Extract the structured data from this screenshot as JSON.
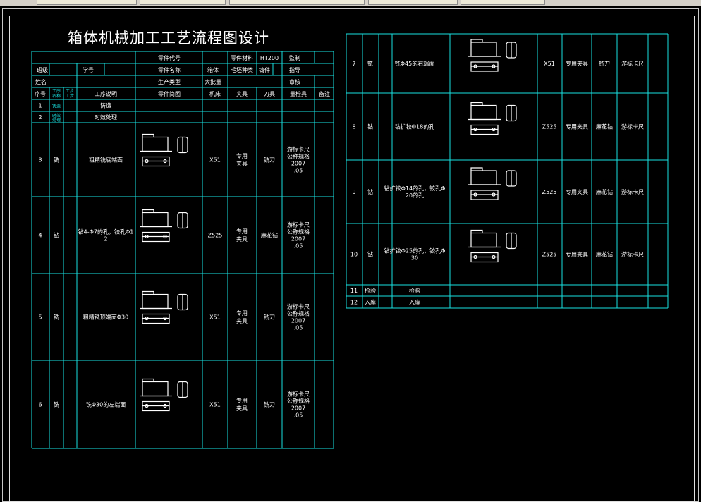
{
  "title": "箱体机械加工工艺流程图设计",
  "header": {
    "part_code_label": "零件代号",
    "part_name_label": "零件名称",
    "batch_label": "生产类型",
    "material_label": "零件材料",
    "material_value": "HT200",
    "blank_type_label": "毛坯种类",
    "blank_type_value": "铸件",
    "part_name_value": "箱体",
    "batch_value": "大批量",
    "made_label": "監制",
    "guide_label": "指导",
    "review_label": "审核",
    "class_label": "班级",
    "student_id_label": "学号",
    "name_label": "姓名"
  },
  "columns": {
    "seq": "序号",
    "proc_name": "工序名称",
    "step_name": "工步工步",
    "desc": "工序说明",
    "sketch": "零件简图",
    "machine": "机床",
    "fixture": "夹具",
    "tool": "刀具",
    "gauge": "量检具",
    "remark": "备注"
  },
  "left_rows": [
    {
      "seq": "1",
      "proc": "铸造",
      "desc": "铸造",
      "machine": "",
      "fixture": "",
      "tool": "",
      "gauge": ""
    },
    {
      "seq": "2",
      "proc": "时效处理",
      "desc": "时效处理",
      "machine": "",
      "fixture": "",
      "tool": "",
      "gauge": ""
    },
    {
      "seq": "3",
      "proc": "铣",
      "desc": "粗精铣底端面",
      "machine": "X51",
      "fixture": "专用夹具",
      "tool": "铣刀",
      "gauge": "游标卡尺公称规格2007.05"
    },
    {
      "seq": "4",
      "proc": "钻",
      "desc": "钻4-Φ7的孔，铰孔Φ12",
      "machine": "Z525",
      "fixture": "专用夹具",
      "tool": "麻花钻",
      "gauge": "游标卡尺公称规格2007.05"
    },
    {
      "seq": "5",
      "proc": "铣",
      "desc": "粗精铣顶端面Φ30",
      "machine": "X51",
      "fixture": "专用夹具",
      "tool": "铣刀",
      "gauge": "游标卡尺公称规格2007.05"
    },
    {
      "seq": "6",
      "proc": "铣",
      "desc": "铣Φ30的左端面",
      "machine": "X51",
      "fixture": "专用夹具",
      "tool": "铣刀",
      "gauge": "游标卡尺公称规格2007.05"
    }
  ],
  "right_rows": [
    {
      "seq": "7",
      "proc": "铣",
      "desc": "铣Φ45的右端面",
      "machine": "X51",
      "fixture": "专用夹具",
      "tool": "铣刀",
      "gauge": "游标卡尺"
    },
    {
      "seq": "8",
      "proc": "钻",
      "desc": "钻扩铰Φ18的孔",
      "machine": "Z525",
      "fixture": "专用夹具",
      "tool": "麻花钻",
      "gauge": "游标卡尺"
    },
    {
      "seq": "9",
      "proc": "钻",
      "desc": "钻扩铰Φ14的孔，铰孔Φ20的孔",
      "machine": "Z525",
      "fixture": "专用夹具",
      "tool": "麻花钻",
      "gauge": "游标卡尺"
    },
    {
      "seq": "10",
      "proc": "钻",
      "desc": "钻扩铰Φ25的孔，铰孔Φ30",
      "machine": "Z525",
      "fixture": "专用夹具",
      "tool": "麻花钻",
      "gauge": "游标卡尺"
    },
    {
      "seq": "11",
      "proc": "检验",
      "desc": "检验",
      "machine": "",
      "fixture": "",
      "tool": "",
      "gauge": ""
    },
    {
      "seq": "12",
      "proc": "入库",
      "desc": "入库",
      "machine": "",
      "fixture": "",
      "tool": "",
      "gauge": ""
    }
  ]
}
